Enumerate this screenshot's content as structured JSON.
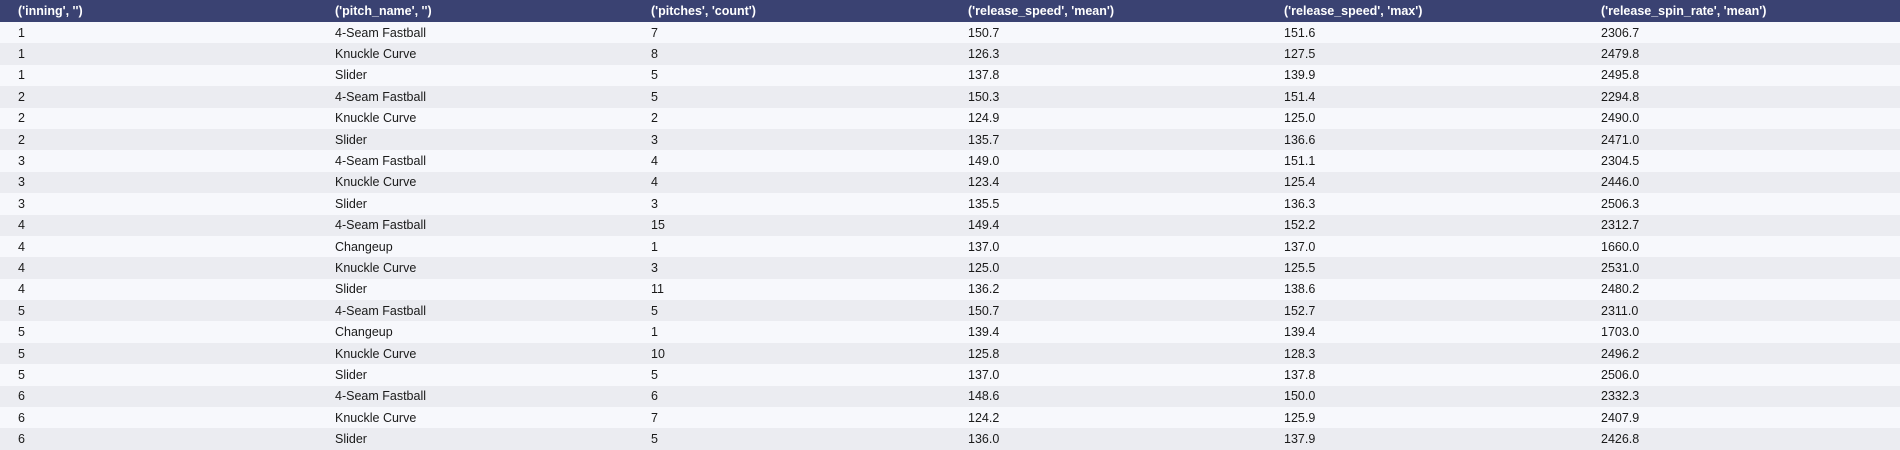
{
  "table": {
    "columns": [
      "('inning', '')",
      "('pitch_name', '')",
      "('pitches', 'count')",
      "('release_speed', 'mean')",
      "('release_speed', 'max')",
      "('release_spin_rate', 'mean')"
    ],
    "rows": [
      [
        "1",
        "4-Seam Fastball",
        "7",
        "150.7",
        "151.6",
        "2306.7"
      ],
      [
        "1",
        "Knuckle Curve",
        "8",
        "126.3",
        "127.5",
        "2479.8"
      ],
      [
        "1",
        "Slider",
        "5",
        "137.8",
        "139.9",
        "2495.8"
      ],
      [
        "2",
        "4-Seam Fastball",
        "5",
        "150.3",
        "151.4",
        "2294.8"
      ],
      [
        "2",
        "Knuckle Curve",
        "2",
        "124.9",
        "125.0",
        "2490.0"
      ],
      [
        "2",
        "Slider",
        "3",
        "135.7",
        "136.6",
        "2471.0"
      ],
      [
        "3",
        "4-Seam Fastball",
        "4",
        "149.0",
        "151.1",
        "2304.5"
      ],
      [
        "3",
        "Knuckle Curve",
        "4",
        "123.4",
        "125.4",
        "2446.0"
      ],
      [
        "3",
        "Slider",
        "3",
        "135.5",
        "136.3",
        "2506.3"
      ],
      [
        "4",
        "4-Seam Fastball",
        "15",
        "149.4",
        "152.2",
        "2312.7"
      ],
      [
        "4",
        "Changeup",
        "1",
        "137.0",
        "137.0",
        "1660.0"
      ],
      [
        "4",
        "Knuckle Curve",
        "3",
        "125.0",
        "125.5",
        "2531.0"
      ],
      [
        "4",
        "Slider",
        "11",
        "136.2",
        "138.6",
        "2480.2"
      ],
      [
        "5",
        "4-Seam Fastball",
        "5",
        "150.7",
        "152.7",
        "2311.0"
      ],
      [
        "5",
        "Changeup",
        "1",
        "139.4",
        "139.4",
        "1703.0"
      ],
      [
        "5",
        "Knuckle Curve",
        "10",
        "125.8",
        "128.3",
        "2496.2"
      ],
      [
        "5",
        "Slider",
        "5",
        "137.0",
        "137.8",
        "2506.0"
      ],
      [
        "6",
        "4-Seam Fastball",
        "6",
        "148.6",
        "150.0",
        "2332.3"
      ],
      [
        "6",
        "Knuckle Curve",
        "7",
        "124.2",
        "125.9",
        "2407.9"
      ],
      [
        "6",
        "Slider",
        "5",
        "136.0",
        "137.9",
        "2426.8"
      ]
    ]
  },
  "colors": {
    "header_bg": "#3a4272",
    "header_text": "#ffffff",
    "row_odd": "#f7f8fc",
    "row_even": "#ebecf1"
  }
}
